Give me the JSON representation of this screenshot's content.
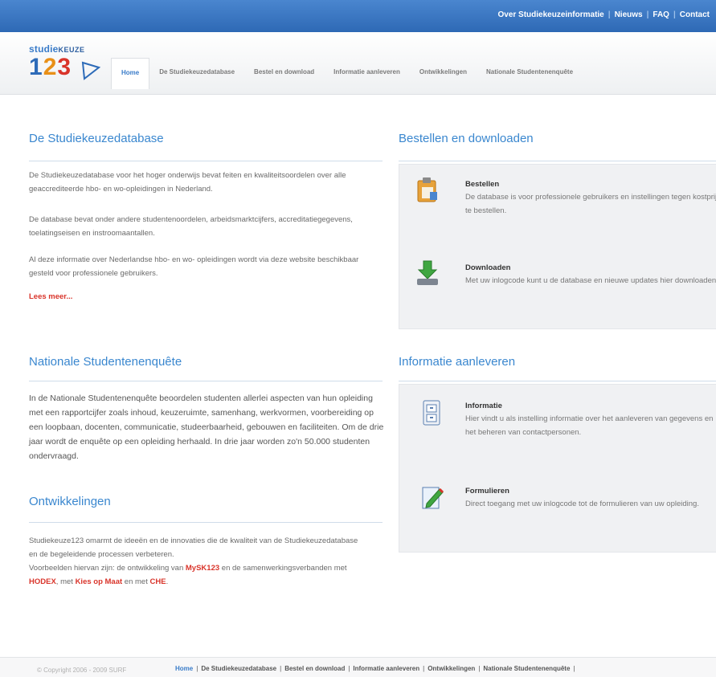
{
  "topbar": {
    "links": [
      "Over Studiekeuzeinformatie",
      "Nieuws",
      "FAQ",
      "Contact"
    ]
  },
  "logo": {
    "word_a": "studie",
    "word_b": "KEUZE",
    "n1": "1",
    "n2": "2",
    "n3": "3"
  },
  "nav": {
    "tabs": [
      "Home",
      "De Studiekeuzedatabase",
      "Bestel en download",
      "Informatie aanleveren",
      "Ontwikkelingen",
      "Nationale Studentenenquête"
    ]
  },
  "studiekeuzedatabase": {
    "title": "De Studiekeuzedatabase",
    "p1": "De Studiekeuzedatabase voor het hoger onderwijs bevat feiten en kwaliteitsoordelen over alle geaccrediteerde hbo- en wo-opleidingen in Nederland.",
    "p2": "De database bevat onder andere studentenoordelen, arbeidsmarktcijfers, accreditatiegegevens, toelatingseisen en instroomaantallen.",
    "p3": "Al deze informatie over Nederlandse hbo- en wo- opleidingen wordt via deze website beschikbaar gesteld voor professionele gebruikers.",
    "more": "Lees meer..."
  },
  "bestellen": {
    "title": "Bestellen en downloaden",
    "items": [
      {
        "title": "Bestellen",
        "desc": "De database is voor professionele gebruikers en instellingen tegen kostprijs te bestellen.",
        "icon": "clipboard-icon"
      },
      {
        "title": "Downloaden",
        "desc": "Met uw inlogcode kunt u de database en nieuwe updates hier downloaden.",
        "icon": "download-icon"
      }
    ]
  },
  "nse": {
    "title": "Nationale Studentenenquête",
    "p1": "In de Nationale Studentenenquête beoordelen studenten allerlei aspecten van hun opleiding met een rapportcijfer zoals inhoud, keuzeruimte, samenhang, werkvormen, voorbereiding op een loopbaan, docenten, communicatie, studeerbaarheid, gebouwen en faciliteiten. Om de drie jaar wordt de enquête op een opleiding herhaald. In drie jaar worden zo'n 50.000 studenten ondervraagd."
  },
  "ontwikkelingen": {
    "title": "Ontwikkelingen",
    "p1": "Studiekeuze123 omarmt de ideeën en de innovaties die de kwaliteit van de Studiekeuzedatabase en de begeleidende processen verbeteren.",
    "p2a": "Voorbeelden hiervan zijn: de ontwikkeling van ",
    "link1": "MySK123",
    "p2b": " en de samenwerkingsverbanden met ",
    "link2": "HODEX",
    "p2c": ", met ",
    "link3": "Kies op Maat",
    "p2d": " en met ",
    "link4": "CHE",
    "p2e": "."
  },
  "informatie": {
    "title": "Informatie aanleveren",
    "items": [
      {
        "title": "Informatie",
        "desc": "Hier vindt u als instelling informatie over het aanleveren van gegevens en het beheren van contactpersonen.",
        "icon": "file-cabinet-icon"
      },
      {
        "title": "Formulieren",
        "desc": "Direct toegang met uw inlogcode tot de formulieren van uw opleiding.",
        "icon": "edit-form-icon"
      }
    ]
  },
  "footer": {
    "copyright": "© Copyright 2006 - 2009 SURF",
    "links": [
      "Home",
      "De Studiekeuzedatabase",
      "Bestel en download",
      "Informatie aanleveren",
      "Ontwikkelingen",
      "Nationale Studentenenquête"
    ]
  },
  "colors": {
    "accent": "#3a87cf",
    "topbar": "#2e69b5",
    "link_red": "#d9342a"
  }
}
